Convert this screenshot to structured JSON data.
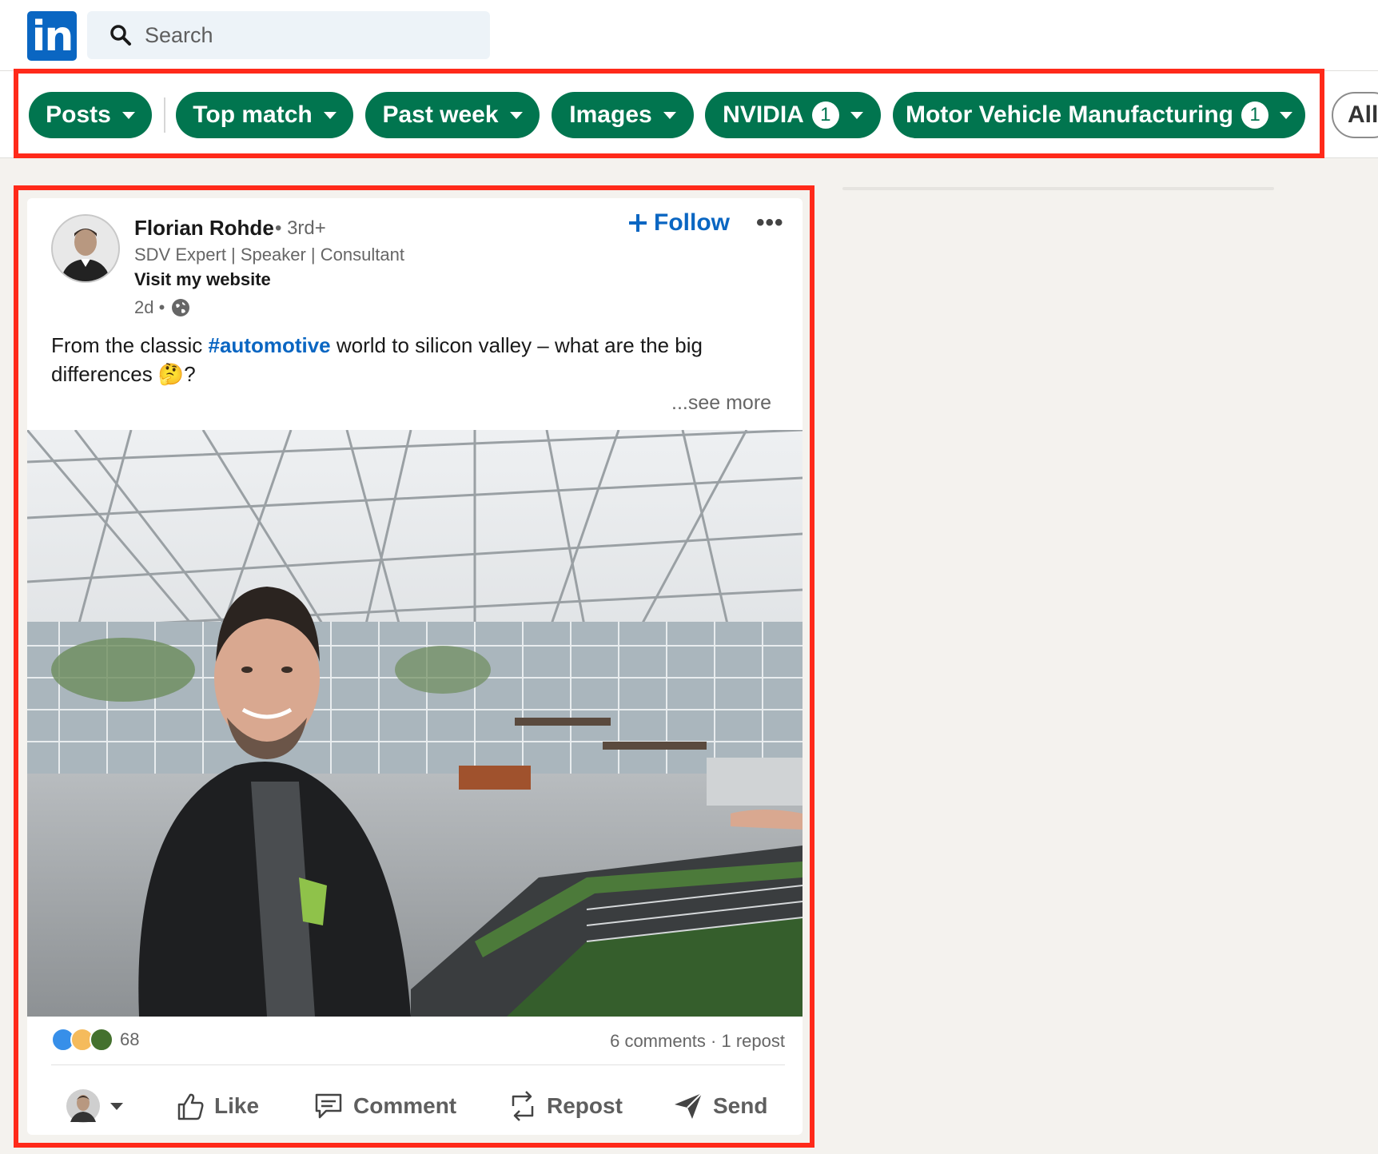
{
  "app": {
    "logo_text": "in"
  },
  "search": {
    "placeholder": "Search"
  },
  "filters": {
    "items": [
      {
        "label": "Posts"
      },
      {
        "label": "Top match"
      },
      {
        "label": "Past week"
      },
      {
        "label": "Images"
      },
      {
        "label": "NVIDIA",
        "count": "1"
      },
      {
        "label": "Motor Vehicle Manufacturing",
        "count": "1"
      }
    ],
    "all_label": "All"
  },
  "post": {
    "author": "Florian Rohde",
    "degree": "• 3rd+",
    "headline": "SDV Expert | Speaker | Consultant",
    "website_link": "Visit my website",
    "time": "2d •",
    "follow_label": "Follow",
    "more_label": "•••",
    "text_before": "From the classic ",
    "hashtag": "#automotive",
    "text_after": " world to silicon valley – what are the big differences 🤔?",
    "see_more": "...see more",
    "reaction_count": "68",
    "comments": "6 comments",
    "reposts": "1 repost",
    "actions": {
      "like": "Like",
      "comment": "Comment",
      "repost": "Repost",
      "send": "Send"
    }
  },
  "colors": {
    "pill_green": "#01754f",
    "link_blue": "#0a66c2",
    "annotation_red": "#ff2a1a"
  }
}
